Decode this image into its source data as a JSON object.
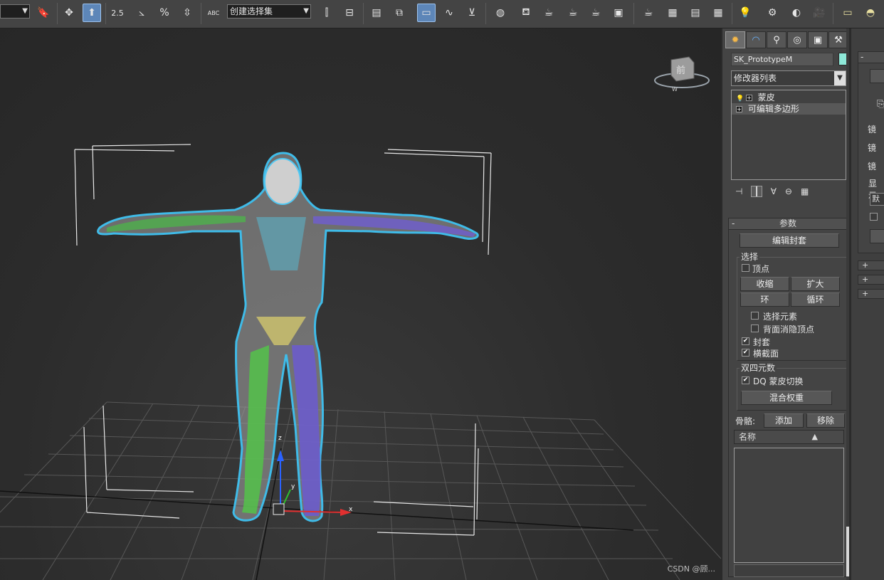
{
  "toolbar": {
    "snap_angle_label": "2.5",
    "percent_label": "%",
    "named_selection_set": "创建选择集",
    "abc_label": "ABC"
  },
  "viewport": {
    "viewcube_face": "前",
    "viewcube_compass": "W",
    "gizmo": {
      "x_label": "x",
      "y_label": "y",
      "z_label": "z"
    },
    "watermark": "CSDN @顾..."
  },
  "command_panel": {
    "object_name": "SK_PrototypeM",
    "object_color": "#8ee8d8",
    "modifier_list": "修改器列表",
    "modifier_stack": [
      {
        "label": "蒙皮",
        "selected": false,
        "has_bulb": true
      },
      {
        "label": "可编辑多边形",
        "selected": true,
        "has_bulb": false
      }
    ],
    "params": {
      "title": "参数",
      "edit_envelope": "编辑封套",
      "selection_group": "选择",
      "vertex": "顶点",
      "shrink": "收缩",
      "grow": "扩大",
      "ring": "环",
      "loop": "循环",
      "select_element": "选择元素",
      "backface_cull": "背面消隐顶点",
      "envelope": "封套",
      "cross_section": "横截面",
      "dq_group": "双四元数",
      "dq_skin_toggle": "DQ 蒙皮切换",
      "blend_weights": "混合权重",
      "bones_label": "骨骼:",
      "add": "添加",
      "remove": "移除",
      "name_header": "名称",
      "sort_arrow": "▲"
    }
  },
  "right_panel": {
    "minus": "-",
    "labels": [
      "镜",
      "镜",
      "镜",
      "显示",
      "默认"
    ]
  }
}
